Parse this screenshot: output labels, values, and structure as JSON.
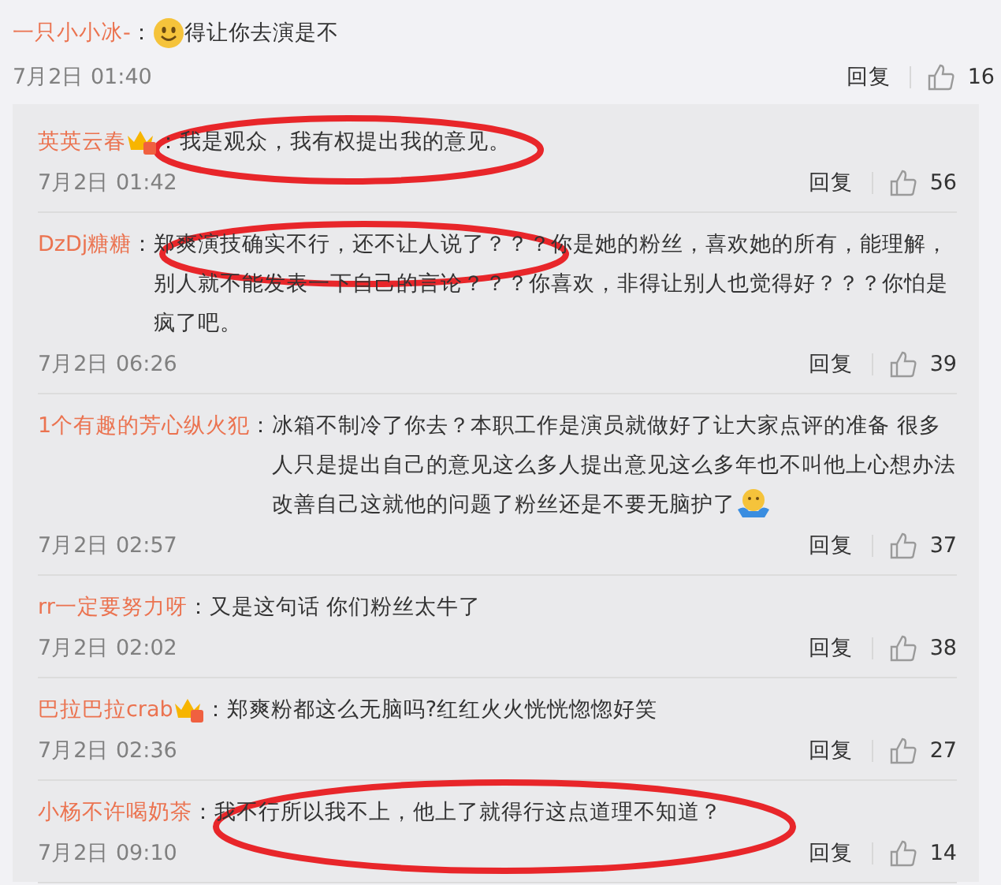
{
  "comment": {
    "user": "一只小小冰-",
    "separator": "：",
    "emoji": true,
    "text": "得让你去演是不",
    "date": "7月2日 01:40",
    "reply_label": "回复",
    "likes": "16"
  },
  "replies": [
    {
      "user": "英英云春",
      "vip_badge": true,
      "separator": "：",
      "text": "我是观众，我有权提出我的意见。",
      "emoji": false,
      "date": "7月2日 01:42",
      "reply_label": "回复",
      "likes": "56",
      "circled": true
    },
    {
      "user": "DzDj糖糖",
      "vip_badge": false,
      "separator": "：",
      "text": "郑爽演技确实不行，还不让人说了？？？你是她的粉丝，喜欢她的所有，能理解，别人就不能发表一下自己的言论？？？你喜欢，非得让别人也觉得好？？？你怕是疯了吧。",
      "emoji": false,
      "date": "7月2日 06:26",
      "reply_label": "回复",
      "likes": "39",
      "circled": true
    },
    {
      "user": "1个有趣的芳心纵火犯",
      "vip_badge": false,
      "separator": "：",
      "text": "冰箱不制冷了你去？本职工作是演员就做好了让大家点评的准备 很多人只是提出自己的意见这么多人提出意见这么多年也不叫他上心想办法改善自己这就他的问题了粉丝还是不要无脑护了",
      "emoji": true,
      "date": "7月2日 02:57",
      "reply_label": "回复",
      "likes": "37",
      "circled": false
    },
    {
      "user": "rr一定要努力呀",
      "vip_badge": false,
      "separator": "：",
      "text": "又是这句话  你们粉丝太牛了",
      "emoji": false,
      "date": "7月2日 02:02",
      "reply_label": "回复",
      "likes": "38",
      "circled": false
    },
    {
      "user": "巴拉巴拉crab",
      "vip_badge": true,
      "separator": "：",
      "text": "郑爽粉都这么无脑吗?红红火火恍恍惚惚好笑",
      "emoji": false,
      "date": "7月2日 02:36",
      "reply_label": "回复",
      "likes": "27",
      "circled": false
    },
    {
      "user": "小杨不许喝奶茶",
      "vip_badge": false,
      "separator": "：",
      "text": "我不行所以我不上，他上了就得行这点道理不知道？",
      "emoji": false,
      "date": "7月2日 09:10",
      "reply_label": "回复",
      "likes": "14",
      "circled": true
    }
  ]
}
